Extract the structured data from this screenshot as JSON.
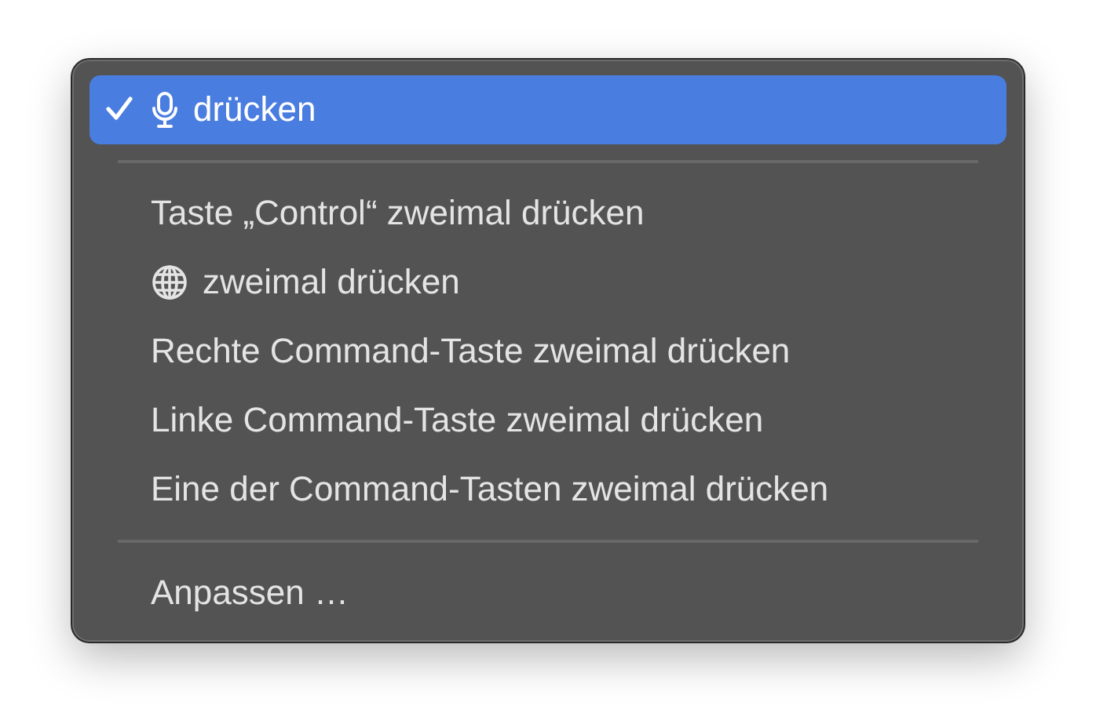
{
  "menu": {
    "items": [
      {
        "kind": "mic-item",
        "label": "drücken",
        "checked": true,
        "selected": true
      },
      {
        "kind": "separator"
      },
      {
        "kind": "item",
        "label": "Taste „Control“ zweimal drücken",
        "checked": false,
        "selected": false
      },
      {
        "kind": "globe-item",
        "label": "zweimal drücken",
        "checked": false,
        "selected": false
      },
      {
        "kind": "item",
        "label": "Rechte Command-Taste zweimal drücken",
        "checked": false,
        "selected": false
      },
      {
        "kind": "item",
        "label": "Linke Command-Taste zweimal drücken",
        "checked": false,
        "selected": false
      },
      {
        "kind": "item",
        "label": "Eine der Command-Tasten zweimal drücken",
        "checked": false,
        "selected": false
      },
      {
        "kind": "separator"
      },
      {
        "kind": "item",
        "label": "Anpassen …",
        "checked": false,
        "selected": false
      }
    ]
  }
}
